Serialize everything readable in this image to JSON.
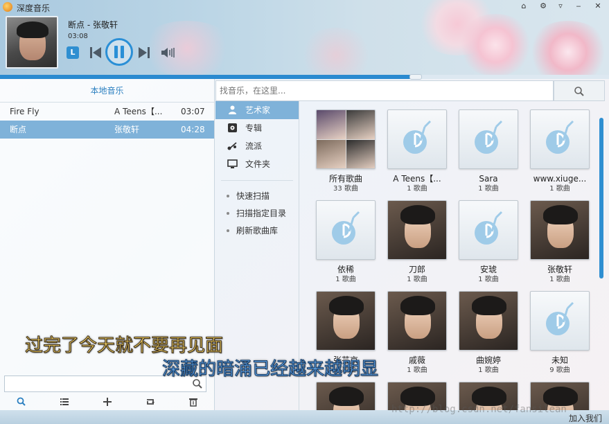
{
  "app": {
    "title": "深度音乐"
  },
  "window_controls": [
    {
      "name": "skin-button",
      "glyph": "⌂"
    },
    {
      "name": "settings-button",
      "glyph": "⚙"
    },
    {
      "name": "menu-button",
      "glyph": "▿"
    },
    {
      "name": "minimize-button",
      "glyph": "‒"
    },
    {
      "name": "close-button",
      "glyph": "✕"
    }
  ],
  "player": {
    "song_title": "断点 - 张敬轩",
    "current_time": "03:08",
    "lyrics_button": "L",
    "progress": 0.683
  },
  "left_panel": {
    "header": "本地音乐",
    "tracks": [
      {
        "name": "Fire Fly",
        "artist": "A Teens【...",
        "duration": "03:07",
        "active": false
      },
      {
        "name": "断点",
        "artist": "张敬轩",
        "duration": "04:28",
        "active": true
      }
    ],
    "search_value": ""
  },
  "search": {
    "placeholder": "找音乐，在这里..."
  },
  "categories": [
    {
      "label": "艺术家",
      "icon": "user-icon",
      "active": true
    },
    {
      "label": "专辑",
      "icon": "disc-icon",
      "active": false
    },
    {
      "label": "流派",
      "icon": "genre-icon",
      "active": false
    },
    {
      "label": "文件夹",
      "icon": "monitor-icon",
      "active": false
    }
  ],
  "actions": [
    {
      "label": "快速扫描"
    },
    {
      "label": "扫描指定目录"
    },
    {
      "label": "刷新歌曲库"
    }
  ],
  "artists": [
    {
      "name": "所有歌曲",
      "count": "33 歌曲",
      "thumb": "collage"
    },
    {
      "name": "A Teens【...",
      "count": "1 歌曲",
      "thumb": "note"
    },
    {
      "name": "Sara",
      "count": "1 歌曲",
      "thumb": "note"
    },
    {
      "name": "www.xiuge...",
      "count": "1 歌曲",
      "thumb": "note"
    },
    {
      "name": "依稀",
      "count": "1 歌曲",
      "thumb": "note"
    },
    {
      "name": "刀郎",
      "count": "1 歌曲",
      "thumb": "photo"
    },
    {
      "name": "安琥",
      "count": "1 歌曲",
      "thumb": "note"
    },
    {
      "name": "张敬轩",
      "count": "1 歌曲",
      "thumb": "photo"
    },
    {
      "name": "张芸京",
      "count": "1 歌曲",
      "thumb": "photo"
    },
    {
      "name": "戚薇",
      "count": "1 歌曲",
      "thumb": "photo"
    },
    {
      "name": "曲婉婷",
      "count": "1 歌曲",
      "thumb": "photo"
    },
    {
      "name": "未知",
      "count": "9 歌曲",
      "thumb": "note"
    },
    {
      "name": "",
      "count": "",
      "thumb": "photo"
    },
    {
      "name": "",
      "count": "",
      "thumb": "photo"
    },
    {
      "name": "",
      "count": "",
      "thumb": "photo"
    },
    {
      "name": "",
      "count": "",
      "thumb": "photo"
    }
  ],
  "lyrics": {
    "line1": "过完了今天就不要再见面",
    "line2": "深藏的暗涌已经越来越明显"
  },
  "status": {
    "join": "加入我们"
  },
  "watermark": "http://blog.csdn.net/fansilean",
  "colors": {
    "accent": "#2a8ad0",
    "selection": "#7fb2d9",
    "lyric_current": "#f3d36a",
    "lyric_next": "#6aa8e6"
  }
}
